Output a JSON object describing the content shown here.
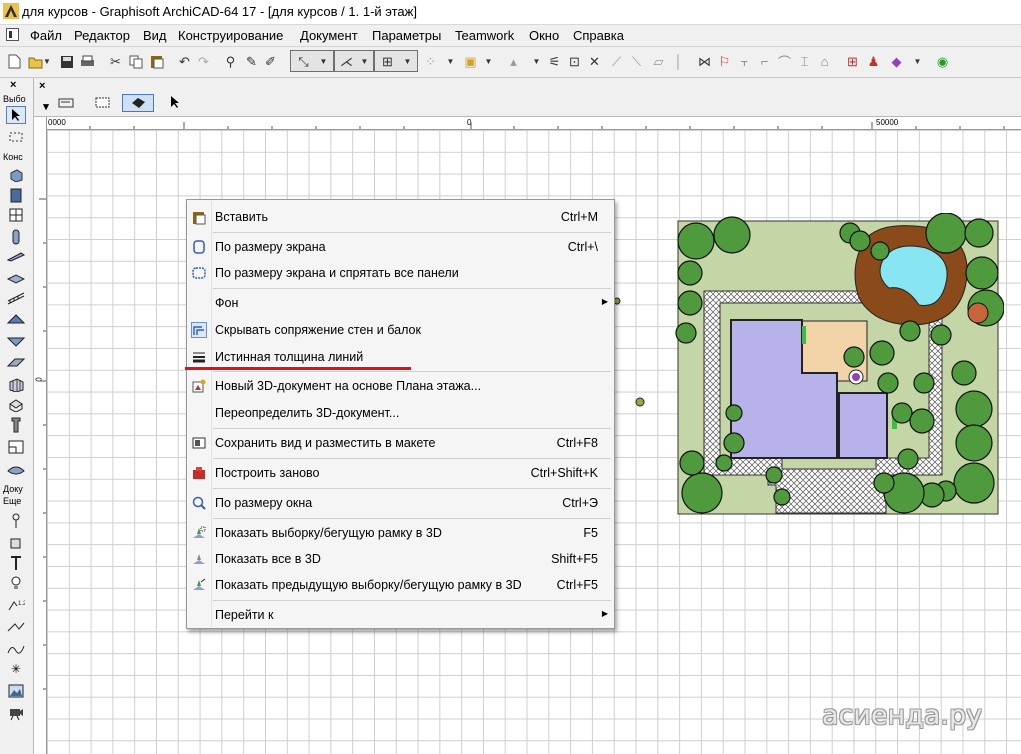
{
  "window": {
    "title": "для курсов - Graphisoft ArchiCAD-64 17 - [для курсов / 1. 1-й этаж]"
  },
  "menubar": {
    "items": [
      "Файл",
      "Редактор",
      "Вид",
      "Конструирование",
      "Документ",
      "Параметры",
      "Teamwork",
      "Окно",
      "Справка"
    ]
  },
  "toolbox": {
    "section_select": "Выбо",
    "section_construct": "Конс",
    "section_document": "Доку",
    "section_more": "Еще"
  },
  "ruler": {
    "left_label": "0000",
    "center_label": "0",
    "right_label": "50000"
  },
  "context_menu": {
    "items": [
      {
        "label": "Вставить",
        "shortcut": "Ctrl+M",
        "icon": "paste-icon"
      },
      {
        "label": "По размеру экрана",
        "shortcut": "Ctrl+\\",
        "icon": "fit-screen-icon"
      },
      {
        "label": "По размеру экрана и спрятать все панели",
        "shortcut": "",
        "icon": "fit-screen-hide-icon"
      },
      {
        "label": "Фон",
        "shortcut": "",
        "icon": "",
        "submenu": true
      },
      {
        "label": "Скрывать сопряжение стен и балок",
        "shortcut": "",
        "icon": "wall-beam-icon",
        "checked": true
      },
      {
        "label": "Истинная толщина линий",
        "shortcut": "",
        "icon": "line-weight-icon"
      },
      {
        "label": "Новый 3D-документ на основе Плана этажа...",
        "shortcut": "",
        "icon": "new-3d-doc-icon"
      },
      {
        "label": "Переопределить 3D-документ...",
        "shortcut": "",
        "icon": ""
      },
      {
        "label": "Сохранить вид и разместить в макете",
        "shortcut": "Ctrl+F8",
        "icon": "save-view-icon"
      },
      {
        "label": "Построить заново",
        "shortcut": "Ctrl+Shift+K",
        "icon": "rebuild-icon"
      },
      {
        "label": "По размеру окна",
        "shortcut": "Ctrl+Э",
        "icon": "fit-window-icon"
      },
      {
        "label": "Показать выборку/бегущую рамку в 3D",
        "shortcut": "F5",
        "icon": "show-selection-3d-icon"
      },
      {
        "label": "Показать все в 3D",
        "shortcut": "Shift+F5",
        "icon": "show-all-3d-icon"
      },
      {
        "label": "Показать предыдущую выборку/бегущую рамку в 3D",
        "shortcut": "Ctrl+F5",
        "icon": "show-prev-3d-icon"
      },
      {
        "label": "Перейти к",
        "shortcut": "",
        "icon": "",
        "submenu": true
      }
    ]
  },
  "watermark": "асиенда.ру",
  "colors": {
    "highlight_line": "#e0101a",
    "building": "#b7b3ea",
    "lawn": "#c5d6a6",
    "tree": "#4e9a3c",
    "pond": "#87e6f2",
    "soil": "#8a4a1a",
    "terrace": "#f2d3a8"
  }
}
